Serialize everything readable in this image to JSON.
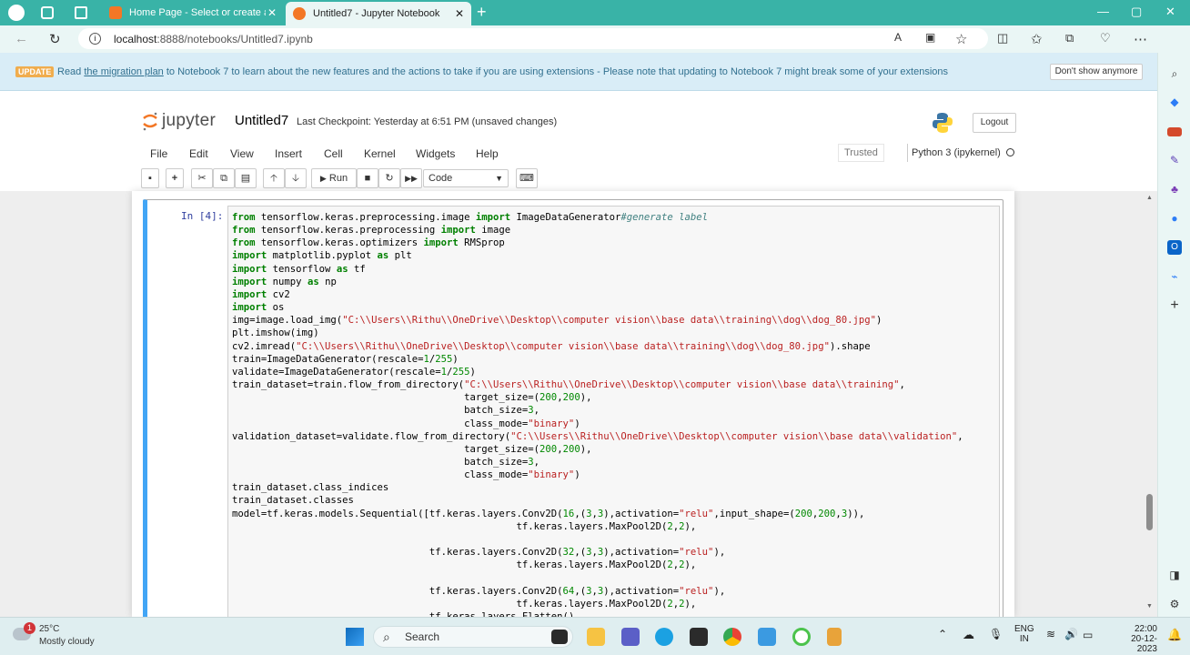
{
  "browser": {
    "tabs": [
      {
        "title": "Home Page - Select or create a n",
        "active": false
      },
      {
        "title": "Untitled7 - Jupyter Notebook",
        "active": true
      }
    ],
    "url_host": "localhost",
    "url_rest": ":8888/notebooks/Untitled7.ipynb"
  },
  "banner": {
    "badge": "UPDATE",
    "text_before": "Read ",
    "link": "the migration plan",
    "text_after": " to Notebook 7 to learn about the new features and the actions to take if you are using extensions - Please note that updating to Notebook 7 might break some of your extensions",
    "dismiss": "Don't show anymore"
  },
  "header": {
    "logo_text": "jupyter",
    "notebook_name": "Untitled7",
    "checkpoint": "Last Checkpoint: Yesterday at 6:51 PM  (unsaved changes)",
    "logout": "Logout"
  },
  "menu": {
    "items": [
      "File",
      "Edit",
      "View",
      "Insert",
      "Cell",
      "Kernel",
      "Widgets",
      "Help"
    ],
    "trusted": "Trusted",
    "kernel": "Python 3 (ipykernel)"
  },
  "toolbar": {
    "run": "Run",
    "cell_type": "Code"
  },
  "cell": {
    "prompt": "In [4]:"
  },
  "taskbar": {
    "weather_temp": "25°C",
    "weather_desc": "Mostly cloudy",
    "weather_badge": "1",
    "search": "Search",
    "lang_top": "ENG",
    "lang_bottom": "IN",
    "time": "22:00",
    "date": "20-12-2023"
  },
  "colors": {
    "tabbar": "#39b3a7",
    "cell_border_active": "#42a5f5",
    "banner_bg": "#d9edf7"
  }
}
